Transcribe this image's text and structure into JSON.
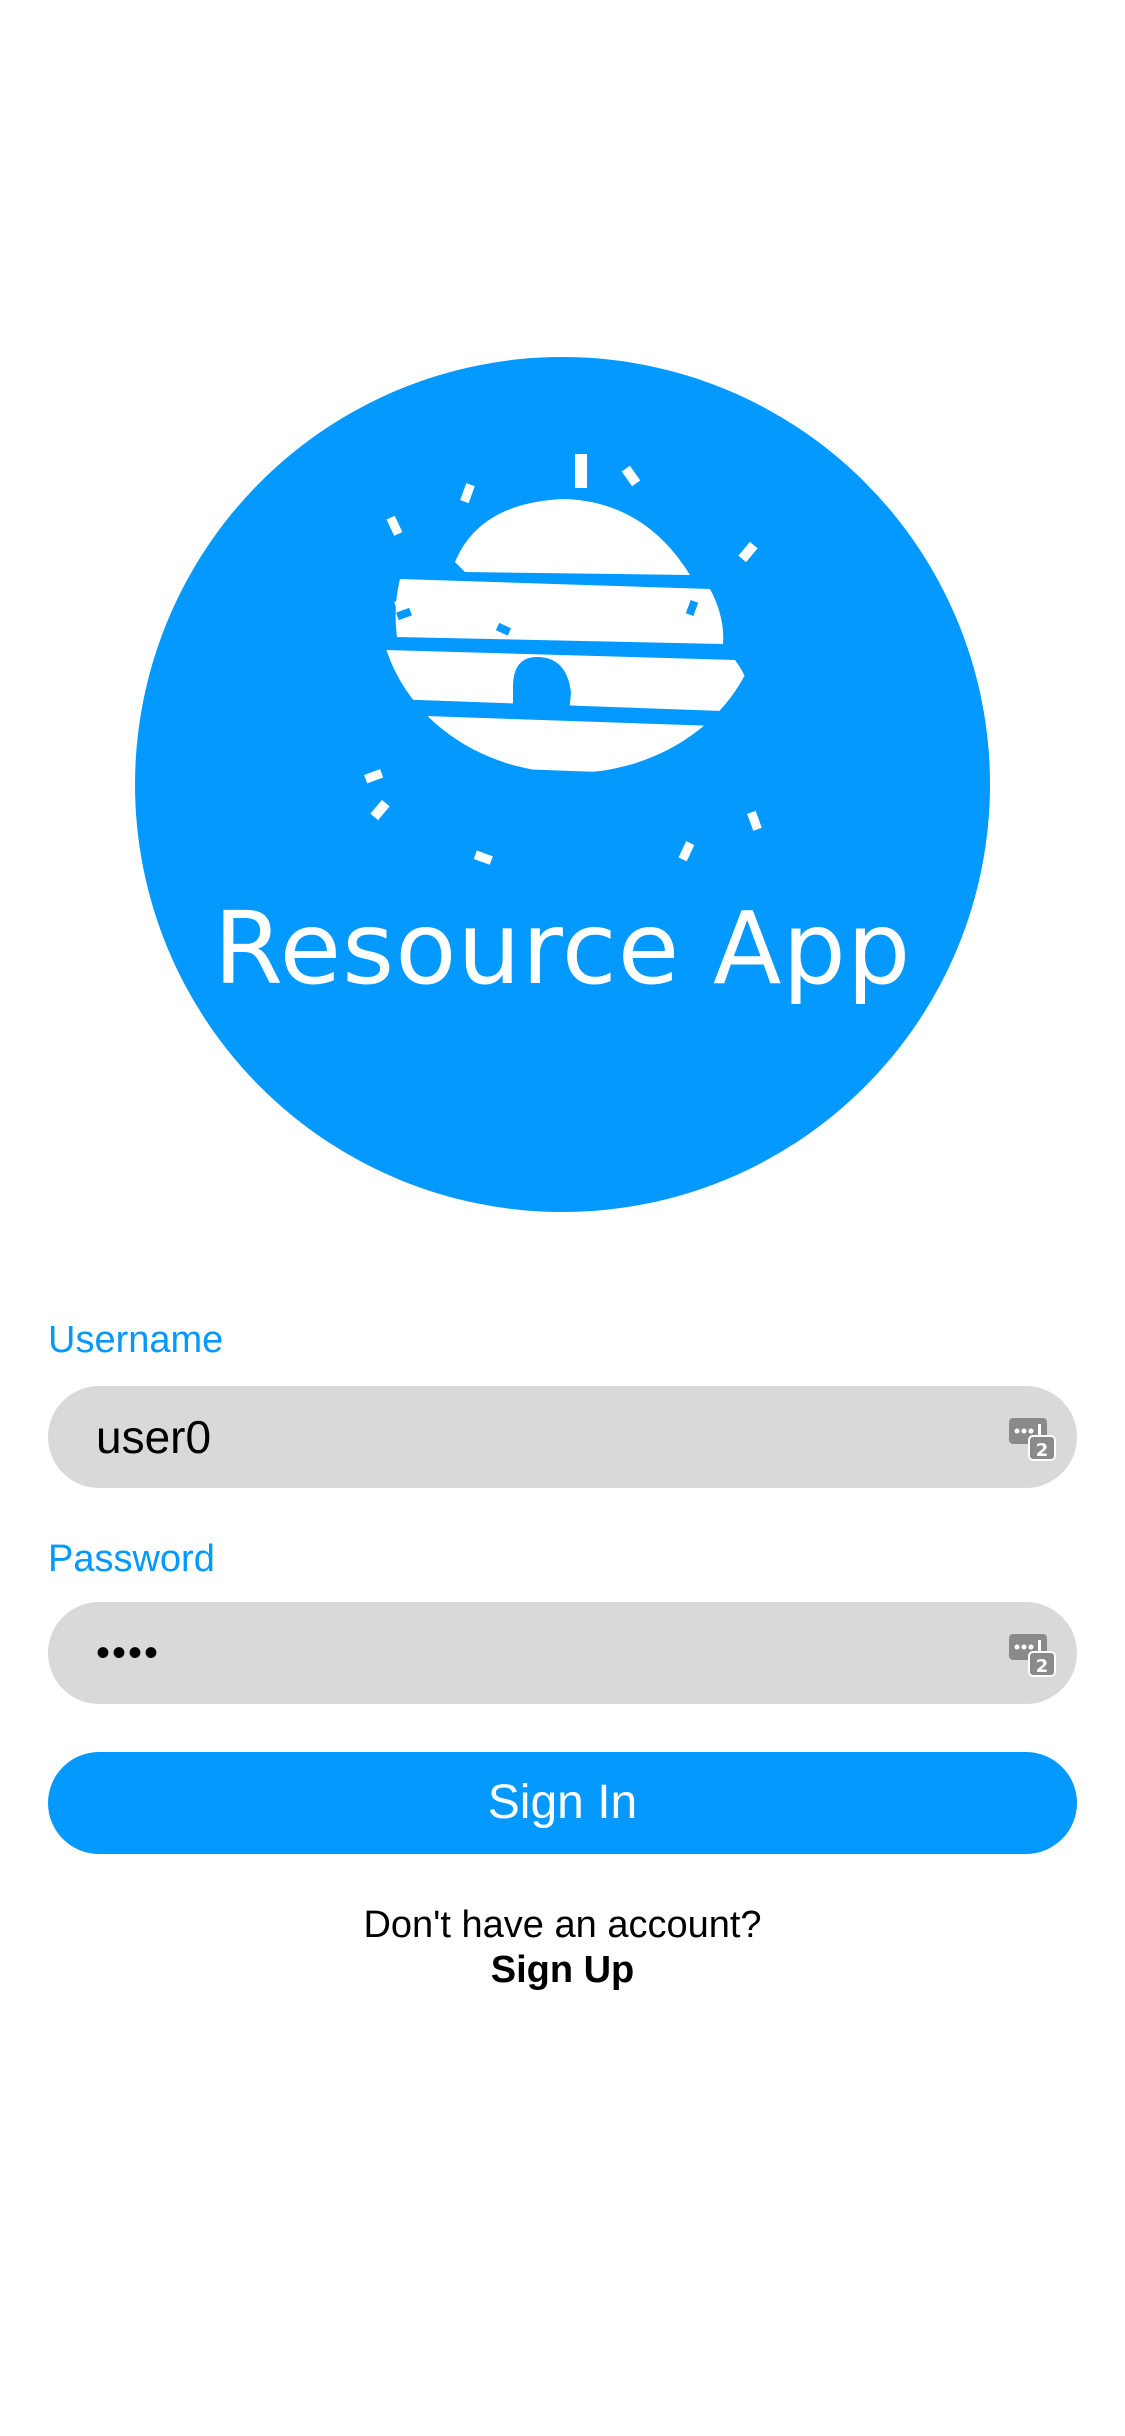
{
  "logo": {
    "app_name": "Resource App",
    "icon": "beehive-icon",
    "background_color": "#0399ff"
  },
  "form": {
    "username_label": "Username",
    "username_value": "user0",
    "password_label": "Password",
    "password_value": "••••",
    "autofill_icon": "password-key-icon",
    "signin_label": "Sign In"
  },
  "footer": {
    "prompt": "Don't have an account?",
    "signup_label": "Sign Up"
  },
  "colors": {
    "accent": "#0399ff",
    "field_background": "#d9d9d9"
  }
}
